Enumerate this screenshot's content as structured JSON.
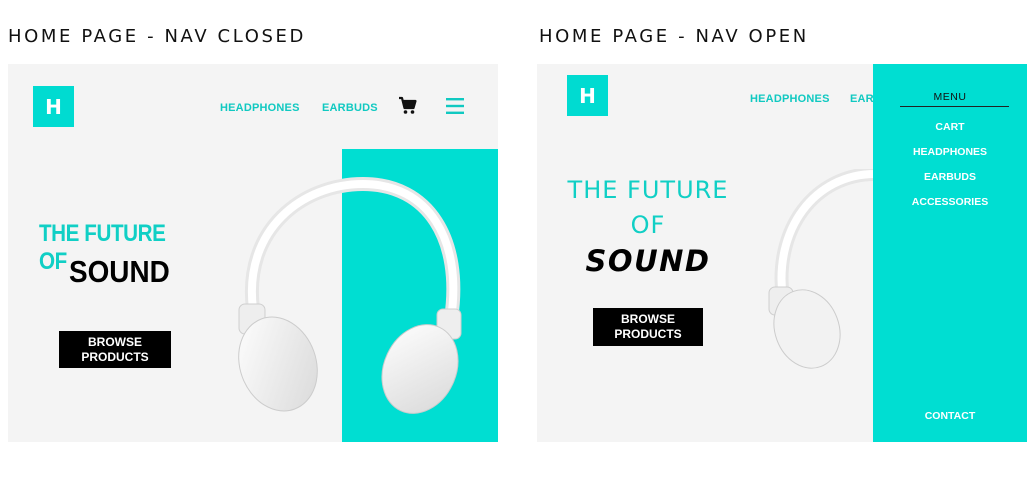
{
  "captions": {
    "closed": "HOME PAGE - NAV CLOSED",
    "open": "HOME PAGE - NAV OPEN"
  },
  "colors": {
    "accent": "#00ded2",
    "background": "#f4f4f4",
    "button": "#000000"
  },
  "nav_closed": {
    "logo": "H",
    "links": [
      "HEADPHONES",
      "EARBUDS"
    ],
    "icons": [
      "cart-icon",
      "hamburger-icon"
    ],
    "hero_line1": "THE FUTURE OF",
    "hero_line2": "SOUND",
    "button_line1": "BROWSE",
    "button_line2": "PRODUCTS"
  },
  "nav_open": {
    "logo": "H",
    "links": [
      "HEADPHONES",
      "EAR"
    ],
    "hero_line1": "THE FUTURE",
    "hero_line2": "OF",
    "hero_line3": "SOUND",
    "button_line1": "BROWSE",
    "button_line2": "PRODUCTS",
    "menu": {
      "title": "MENU",
      "items": [
        "CART",
        "HEADPHONES",
        "EARBUDS",
        "ACCESSORIES"
      ],
      "contact": "CONTACT"
    }
  }
}
